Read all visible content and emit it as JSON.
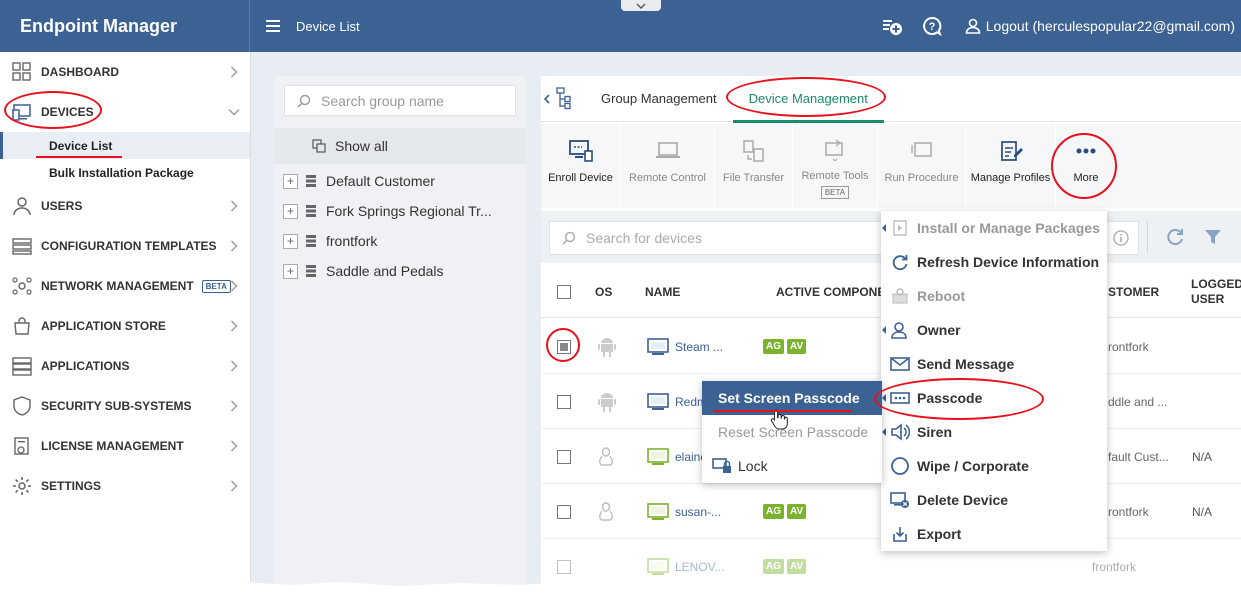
{
  "app": {
    "title": "Endpoint Manager",
    "page_title": "Device List"
  },
  "header": {
    "logout_label": "Logout (herculespopular22@gmail.com)"
  },
  "sidebar": {
    "items": [
      {
        "label": "DASHBOARD",
        "icon": "dashboard-icon"
      },
      {
        "label": "DEVICES",
        "icon": "devices-icon"
      },
      {
        "label": "USERS",
        "icon": "user-icon"
      },
      {
        "label": "CONFIGURATION TEMPLATES",
        "icon": "templates-icon"
      },
      {
        "label": "NETWORK MANAGEMENT",
        "icon": "network-icon",
        "badge": "BETA"
      },
      {
        "label": "APPLICATION STORE",
        "icon": "store-icon"
      },
      {
        "label": "APPLICATIONS",
        "icon": "applications-icon"
      },
      {
        "label": "SECURITY SUB-SYSTEMS",
        "icon": "shield-icon"
      },
      {
        "label": "LICENSE MANAGEMENT",
        "icon": "license-icon"
      },
      {
        "label": "SETTINGS",
        "icon": "gear-icon"
      }
    ],
    "devices_sub": [
      "Device List",
      "Bulk Installation Package"
    ]
  },
  "groups": {
    "search_placeholder": "Search group name",
    "show_all": "Show all",
    "tree": [
      "Default Customer",
      "Fork Springs Regional Tr...",
      "frontfork",
      "Saddle and Pedals"
    ]
  },
  "tabs": [
    "Group Management",
    "Device Management"
  ],
  "toolbar": [
    {
      "label": "Enroll Device",
      "icon": "enroll-device-icon"
    },
    {
      "label": "Remote Control",
      "icon": "remote-control-icon"
    },
    {
      "label": "File Transfer",
      "icon": "file-transfer-icon"
    },
    {
      "label": "Remote Tools",
      "icon": "remote-tools-icon",
      "badge": "BETA"
    },
    {
      "label": "Run Procedure",
      "icon": "run-procedure-icon"
    },
    {
      "label": "Manage Profiles",
      "icon": "manage-profiles-icon"
    },
    {
      "label": "More",
      "icon": "more-icon"
    }
  ],
  "device_search": {
    "placeholder": "Search for devices"
  },
  "table": {
    "headers": {
      "os": "OS",
      "name": "NAME",
      "active": "ACTIVE COMPONEN",
      "customer": "STOMER",
      "logged": "LOGGED USER"
    },
    "rows": [
      {
        "name": "Steam ...",
        "badges": [
          "AG",
          "AV"
        ],
        "customer": "rontfork",
        "logged": ""
      },
      {
        "name": "Redm",
        "badges": [],
        "customer": "ddle and ...",
        "logged": ""
      },
      {
        "name": "elaine",
        "badges": [],
        "customer": "fault Cust...",
        "logged": "N/A"
      },
      {
        "name": "susan-...",
        "badges": [
          "AG",
          "AV"
        ],
        "customer": "rontfork",
        "logged": "N/A"
      },
      {
        "name": "LENOV...",
        "badges": [
          "AG",
          "AV"
        ],
        "customer": "frontfork",
        "logged": ""
      }
    ]
  },
  "more_menu": [
    "Install or Manage Packages",
    "Refresh Device Information",
    "Reboot",
    "Owner",
    "Send Message",
    "Passcode",
    "Siren",
    "Wipe / Corporate",
    "Delete Device",
    "Export"
  ],
  "passcode_menu": [
    "Set Screen Passcode",
    "Reset Screen Passcode",
    "Lock"
  ],
  "colors": {
    "header": "#3c6193",
    "accent_green": "#1b8b6a",
    "badge_green": "#7bb32e",
    "annotation_red": "#e8101c"
  }
}
